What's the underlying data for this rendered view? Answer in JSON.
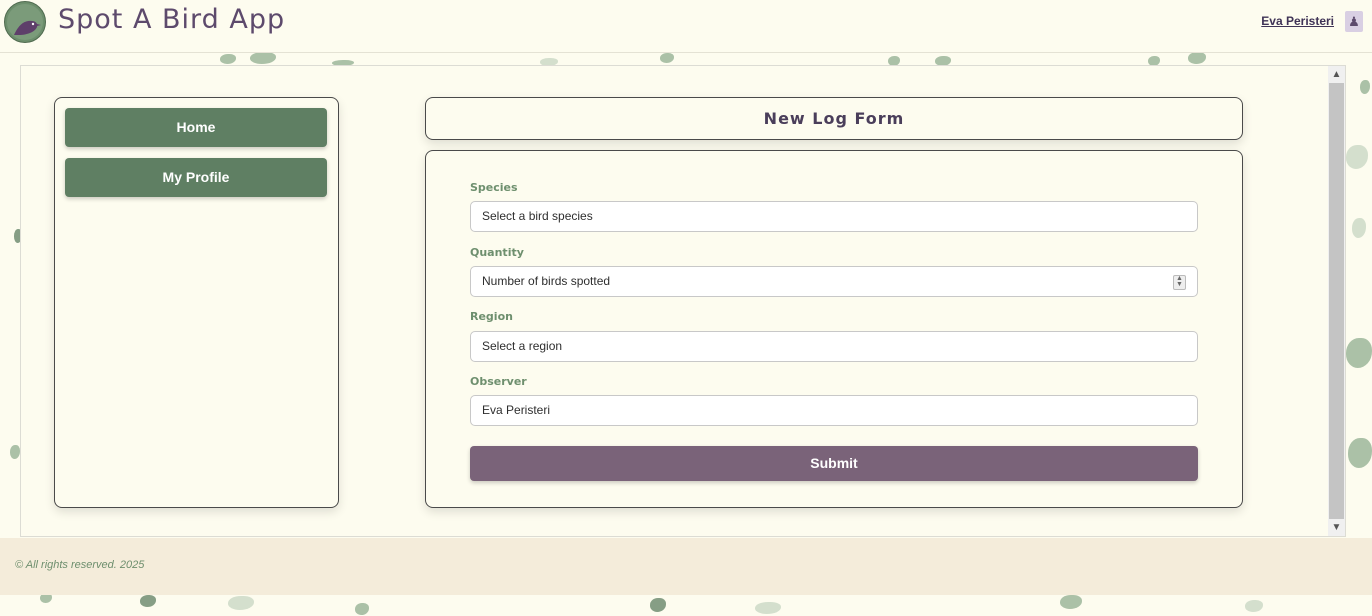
{
  "header": {
    "app_title": "Spot A Bird App",
    "user_name": "Eva Peristeri",
    "logo_icon": "bird-logo-icon",
    "user_icon": "person-icon"
  },
  "sidebar": {
    "items": [
      {
        "label": "Home"
      },
      {
        "label": "My Profile"
      }
    ]
  },
  "form": {
    "title": "New Log Form",
    "fields": [
      {
        "label": "Species",
        "value": "Select a bird species"
      },
      {
        "label": "Quantity",
        "value": "Number of birds spotted"
      },
      {
        "label": "Region",
        "value": "Select a region"
      },
      {
        "label": "Observer",
        "value": "Eva Peristeri"
      }
    ],
    "submit_label": "Submit"
  },
  "footer": {
    "text": "© All rights reserved. 2025"
  },
  "colors": {
    "background": "#fdfcef",
    "nav_button": "#5f7f63",
    "submit_button": "#7a6379",
    "label_green": "#6e8f6e",
    "title_purple": "#5d4a6c",
    "footer_bg": "#f4ecda"
  }
}
